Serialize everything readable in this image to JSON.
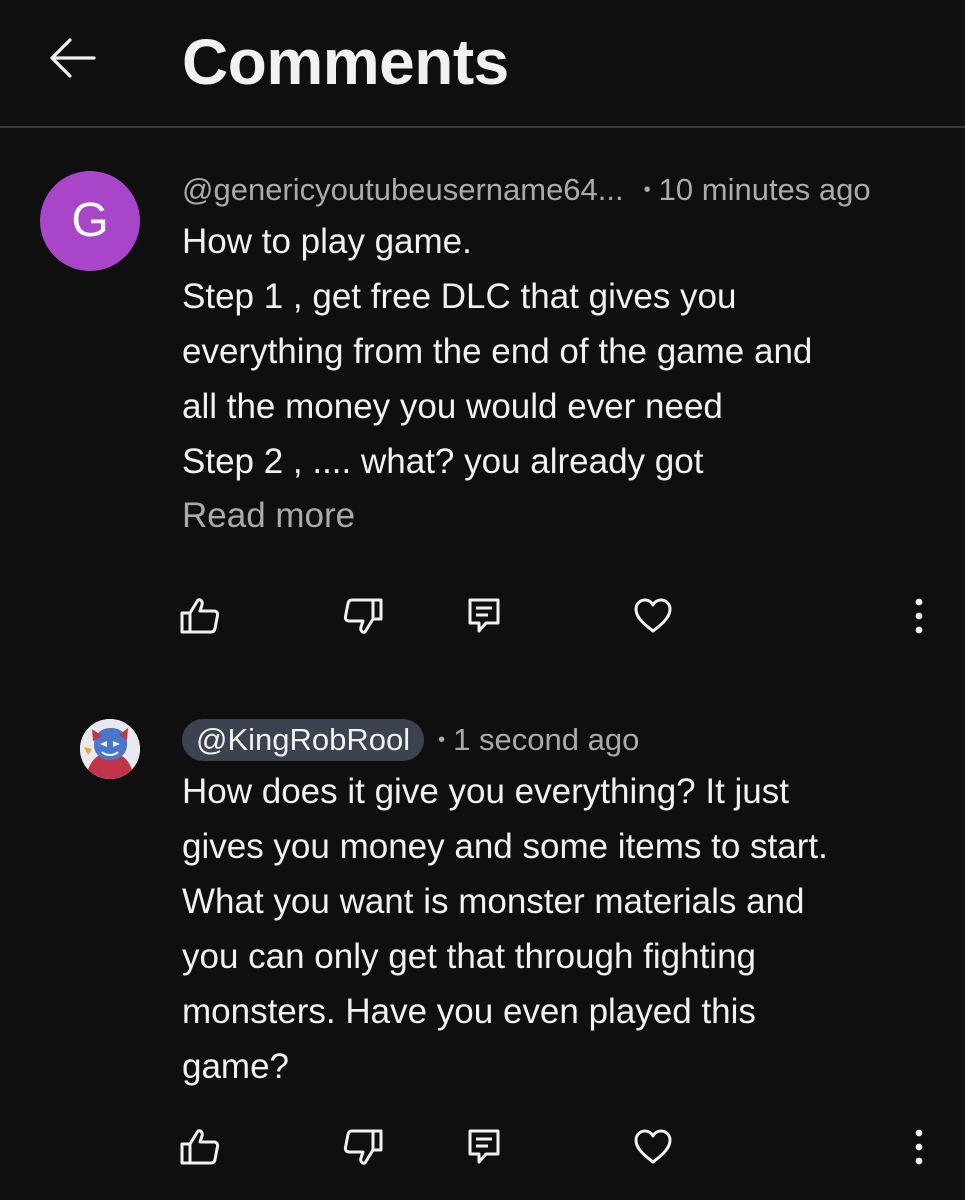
{
  "header": {
    "title": "Comments",
    "back_icon": "arrow-left-icon"
  },
  "comments": [
    {
      "avatar_letter": "G",
      "avatar_color": "#a945c9",
      "username": "@genericyoutubeusername64...",
      "separator": "•",
      "time": "10 minutes ago",
      "text": "How to play game.\nStep 1 , get free DLC that gives you\neverything from the end of the game and\nall the money you would ever need\nStep 2 , .... what? you already got",
      "read_more": "Read more",
      "actions": [
        "thumbs-up-icon",
        "thumbs-down-icon",
        "reply-icon",
        "heart-icon",
        "more-vertical-icon"
      ]
    },
    {
      "avatar": "profile-image",
      "username": "@KingRobRool",
      "username_highlight_color": "#3a434f",
      "separator": "•",
      "time": "1 second ago",
      "text": "How does it give you everything? It just\ngives you money and some items to start.\nWhat you want is monster materials and\nyou can only get that through fighting\nmonsters. Have you even played this\ngame?",
      "actions": [
        "thumbs-up-icon",
        "thumbs-down-icon",
        "reply-icon",
        "heart-icon",
        "more-vertical-icon"
      ]
    }
  ],
  "colors": {
    "background": "#0f0f0f",
    "text_primary": "#f1f1f1",
    "text_secondary": "#aaaaaa",
    "divider": "#3a3a3a"
  }
}
